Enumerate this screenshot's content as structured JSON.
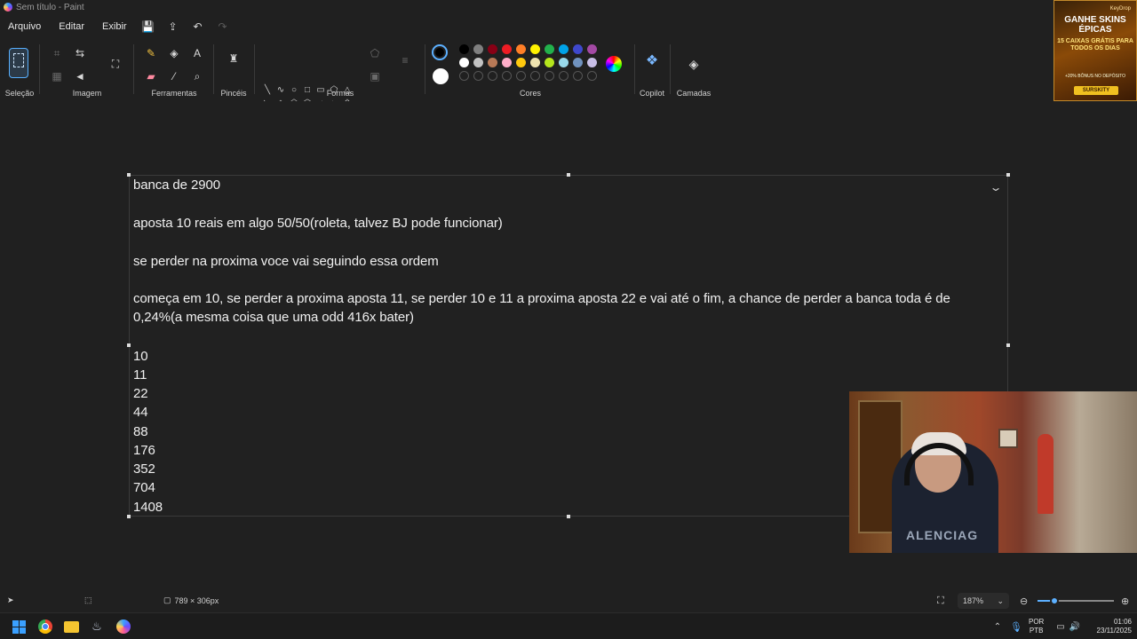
{
  "window": {
    "title": "Sem título - Paint"
  },
  "menu": {
    "items": [
      "Arquivo",
      "Editar",
      "Exibir"
    ],
    "quick_icons": [
      "save-icon",
      "share-icon",
      "undo-icon",
      "redo-icon"
    ]
  },
  "ribbon": {
    "groups": {
      "selection": "Seleção",
      "image": "Imagem",
      "tools": "Ferramentas",
      "brushes": "Pincéis",
      "shapes": "Formas",
      "colors": "Cores",
      "copilot": "Copilot",
      "layers": "Camadas"
    },
    "shape_glyphs": [
      "╲",
      "∿",
      "○",
      "□",
      "▭",
      "⬠",
      "△",
      "◺",
      "◇",
      "⬠",
      "⬡",
      "⇨",
      "⇦",
      "⇧",
      "⇩",
      "✦",
      "☆",
      "✶",
      "◯",
      "▢",
      "◌"
    ],
    "palette_row1": [
      "#000000",
      "#7f7f7f",
      "#880015",
      "#ed1c24",
      "#ff7f27",
      "#fff200",
      "#22b14c",
      "#00a2e8",
      "#3f48cc",
      "#a349a4"
    ],
    "palette_row2": [
      "#ffffff",
      "#c3c3c3",
      "#b97a57",
      "#ffaec9",
      "#ffc90e",
      "#efe4b0",
      "#b5e61d",
      "#99d9ea",
      "#7092be",
      "#c8bfe7"
    ],
    "primary_color": "#000000",
    "secondary_color": "#ffffff"
  },
  "ad": {
    "brand": "KeyDrop",
    "title": "GANHE SKINS ÉPICAS",
    "subtitle": "15 CAIXAS GRÁTIS PARA TODOS OS DIAS",
    "fine": "+20% BÔNUS NO DEPÓSITO",
    "code": "SURSKITY"
  },
  "document": {
    "lines": [
      "banca de 2900",
      "aposta 10 reais em algo 50/50(roleta, talvez BJ pode funcionar)",
      "se perder na proxima voce vai seguindo essa ordem",
      "começa em 10, se perder a proxima aposta 11, se perder 10 e 11 a proxima aposta 22 e vai até o fim, a chance de perder a banca toda é de",
      "0,24%(a mesma coisa que uma odd 416x bater)"
    ],
    "sequence": [
      "10",
      "11",
      "22",
      "44",
      "88",
      "176",
      "352",
      "704",
      "1408"
    ]
  },
  "webcam": {
    "shirt_text": "ALENCIAG"
  },
  "status": {
    "canvas_size": "789 × 306px",
    "zoom": "187%",
    "zoom_fraction": 0.22
  },
  "taskbar": {
    "apps": [
      "start-icon",
      "chrome-icon",
      "file-explorer-icon",
      "steam-icon",
      "paint-icon"
    ],
    "lang_top": "POR",
    "lang_bottom": "PTB",
    "time": "01:06",
    "date": "23/11/2025"
  }
}
